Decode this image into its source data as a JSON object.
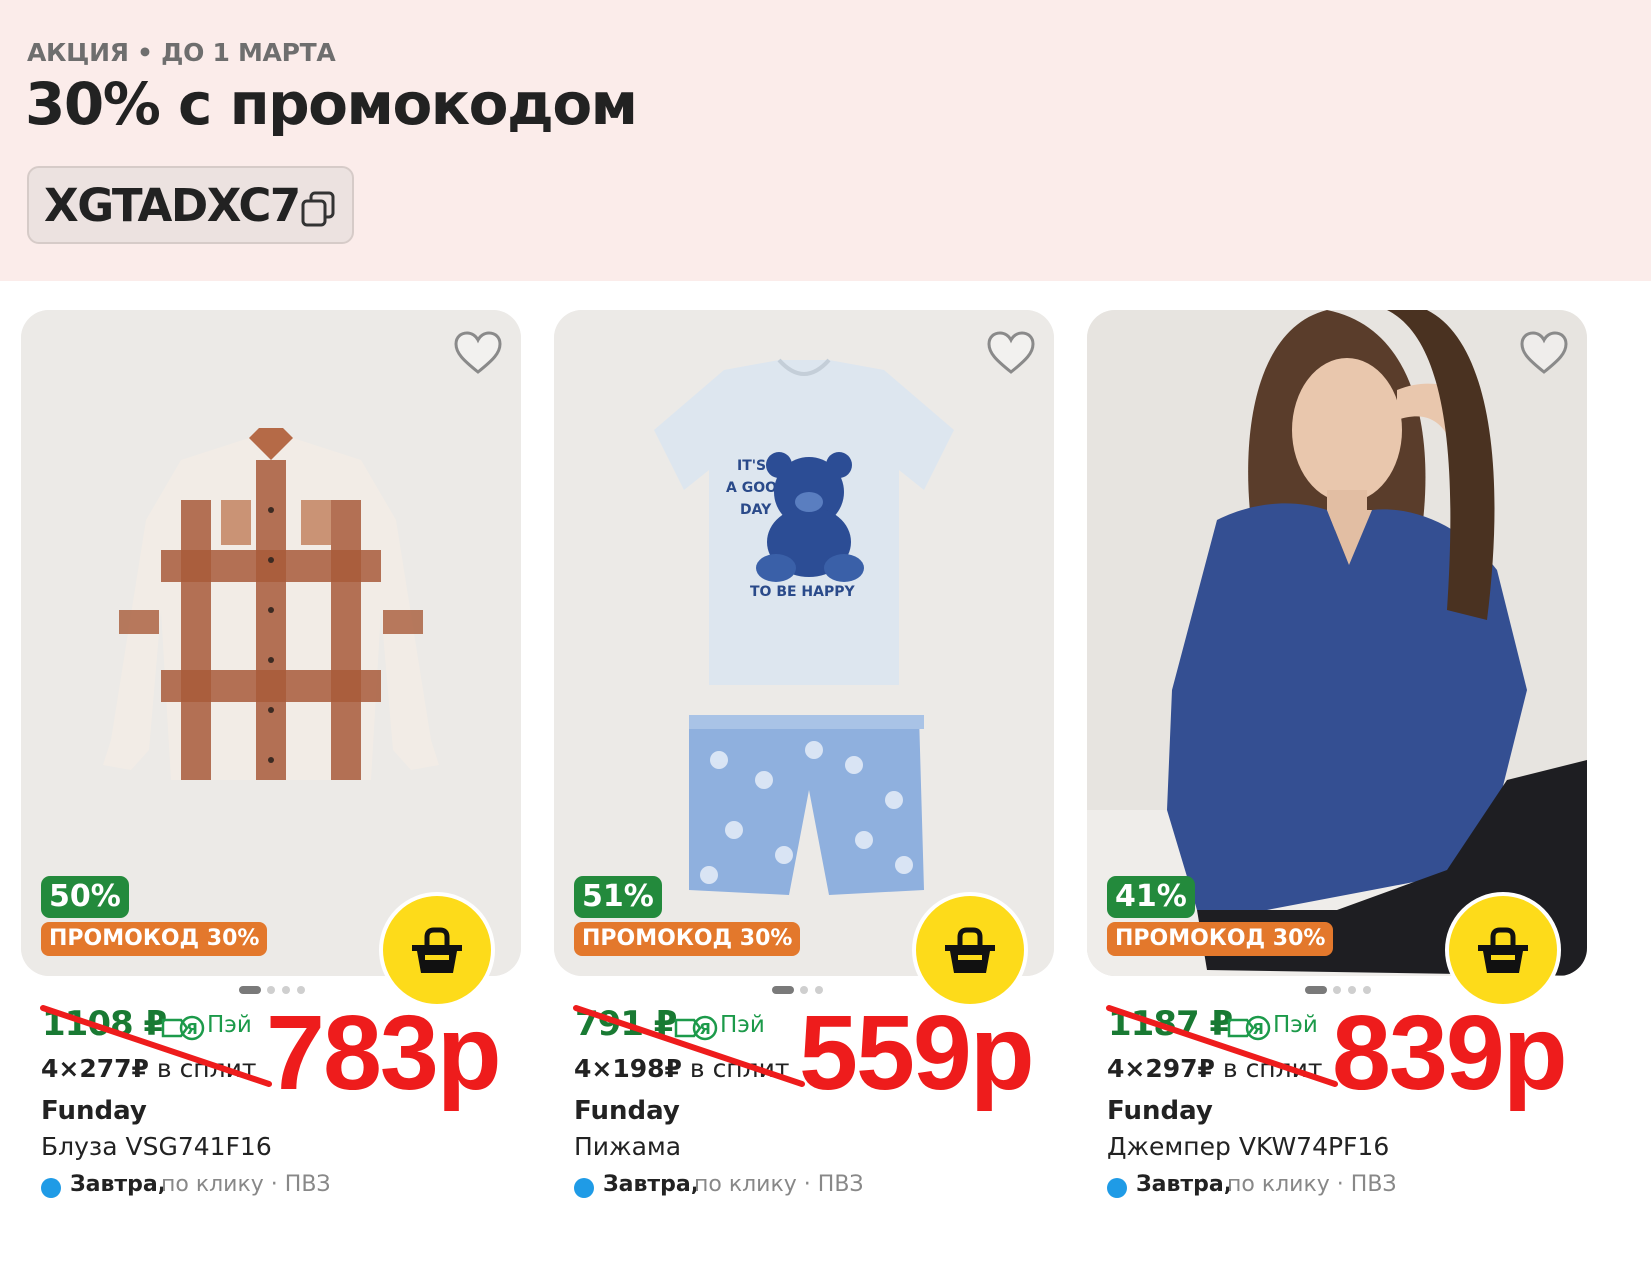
{
  "promo": {
    "kicker": "АКЦИЯ • ДО 1 МАРТА",
    "title": "30% с промокодом",
    "code": "XGTADXC7",
    "copy_icon": "copy-icon"
  },
  "colors": {
    "banner_bg": "#fbecea",
    "discount_badge": "#238a3c",
    "promo_badge": "#e3782c",
    "cart_button": "#fddb1a",
    "old_price": "#197a33",
    "new_price_overlay": "#ee1c1c",
    "delivery_dot": "#1f9be6"
  },
  "products": [
    {
      "image": "plaid-shirt-photo",
      "discount": "50%",
      "promo_badge": "ПРОМОКОД 30%",
      "old_price": "1108 ₽",
      "pay_label": "Пэй",
      "split_amount": "4×277₽",
      "split_suffix": " в сплит",
      "new_price": "783р",
      "brand": "Funday",
      "name": "Блуза VSG741F16",
      "delivery_day": "Завтра,",
      "delivery_rest": "по клику · ПВЗ"
    },
    {
      "image": "pajama-set-photo",
      "discount": "51%",
      "promo_badge": "ПРОМОКОД 30%",
      "old_price": "791 ₽",
      "pay_label": "Пэй",
      "split_amount": "4×198₽",
      "split_suffix": " в сплит",
      "new_price": "559р",
      "brand": "Funday",
      "name": "Пижама",
      "delivery_day": "Завтра,",
      "delivery_rest": "по клику · ПВЗ"
    },
    {
      "image": "blue-sweater-model-photo",
      "discount": "41%",
      "promo_badge": "ПРОМОКОД 30%",
      "old_price": "1187 ₽",
      "pay_label": "Пэй",
      "split_amount": "4×297₽",
      "split_suffix": " в сплит",
      "new_price": "839р",
      "brand": "Funday",
      "name": "Джемпер VKW74PF16",
      "delivery_day": "Завтра,",
      "delivery_rest": "по клику · ПВЗ"
    }
  ],
  "tshirt_print": {
    "line1": "IT'S",
    "line2": "A GOOD",
    "line3": "DAY",
    "line4": "TO BE HAPPY"
  }
}
